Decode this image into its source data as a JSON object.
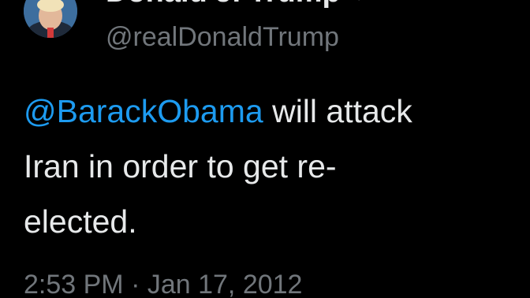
{
  "author": {
    "display_name": "Donald J. Trump",
    "handle": "@realDonaldTrump",
    "verified": true,
    "avatar_icon": "profile-photo"
  },
  "tweet": {
    "mention": "@BarackObama",
    "text_line1": " will attack",
    "text_line2": "Iran in order to get re-",
    "text_line3": "elected."
  },
  "meta": {
    "time": "2:53 PM",
    "separator": " · ",
    "date": "Jan 17, 2012"
  },
  "colors": {
    "background": "#000000",
    "text": "#e7e9ea",
    "secondary": "#71767b",
    "link": "#1d9bf0"
  }
}
